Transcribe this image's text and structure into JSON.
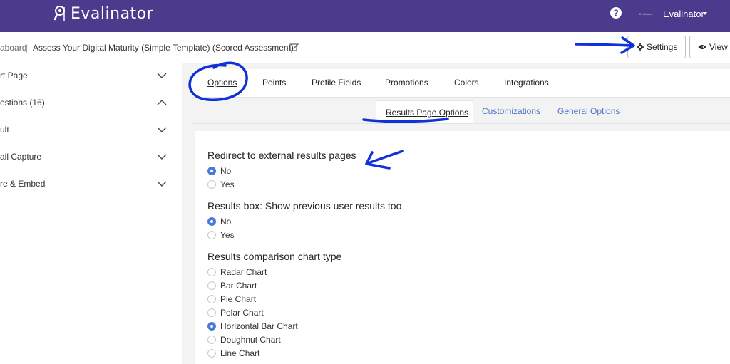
{
  "app": {
    "brand": "Evalinator",
    "help": "?"
  },
  "user": {
    "mini_label": "Evalinator",
    "name": "Evalinator"
  },
  "breadcrumb": {
    "parent": "aboard",
    "separator": "|",
    "current": "Assess Your Digital Maturity (Simple Template) (Scored Assessment)"
  },
  "toolbar": {
    "settings_label": "Settings",
    "view_label": "View"
  },
  "sidebar": {
    "items": [
      {
        "label": "rt Page",
        "expanded": false
      },
      {
        "label": "estions (16)",
        "expanded": true
      },
      {
        "label": "ult",
        "expanded": false
      },
      {
        "label": "ail Capture",
        "expanded": false
      },
      {
        "label": "re & Embed",
        "expanded": false
      }
    ]
  },
  "tabs": [
    {
      "label": "Options",
      "active": true
    },
    {
      "label": "Points",
      "active": false
    },
    {
      "label": "Profile Fields",
      "active": false
    },
    {
      "label": "Promotions",
      "active": false
    },
    {
      "label": "Colors",
      "active": false
    },
    {
      "label": "Integrations",
      "active": false
    }
  ],
  "subtabs": [
    {
      "label": "Results Page Options",
      "active": true
    },
    {
      "label": "Customizations",
      "active": false
    },
    {
      "label": "General Options",
      "active": false
    }
  ],
  "settings": {
    "redirect": {
      "title": "Redirect to external results pages",
      "options": [
        {
          "label": "No",
          "checked": true
        },
        {
          "label": "Yes",
          "checked": false
        }
      ]
    },
    "results_box": {
      "title": "Results box: Show previous user results too",
      "options": [
        {
          "label": "No",
          "checked": true
        },
        {
          "label": "Yes",
          "checked": false
        }
      ]
    },
    "chart_type": {
      "title": "Results comparison chart type",
      "options": [
        {
          "label": "Radar Chart",
          "checked": false
        },
        {
          "label": "Bar Chart",
          "checked": false
        },
        {
          "label": "Pie Chart",
          "checked": false
        },
        {
          "label": "Polar Chart",
          "checked": false
        },
        {
          "label": "Horizontal Bar Chart",
          "checked": true
        },
        {
          "label": "Doughnut Chart",
          "checked": false
        },
        {
          "label": "Line Chart",
          "checked": false
        }
      ]
    }
  },
  "colors": {
    "header": "#4a3b8c",
    "accent": "#4a7bdc",
    "link": "#4b72c8",
    "annotation": "#1230d8"
  },
  "icons": {
    "logo": "magnifier-logo-icon",
    "help": "question-circle-icon",
    "edit": "edit-icon",
    "settings": "gear-icon",
    "view": "eye-icon",
    "sidebar_chevron": "chevron-icon"
  }
}
